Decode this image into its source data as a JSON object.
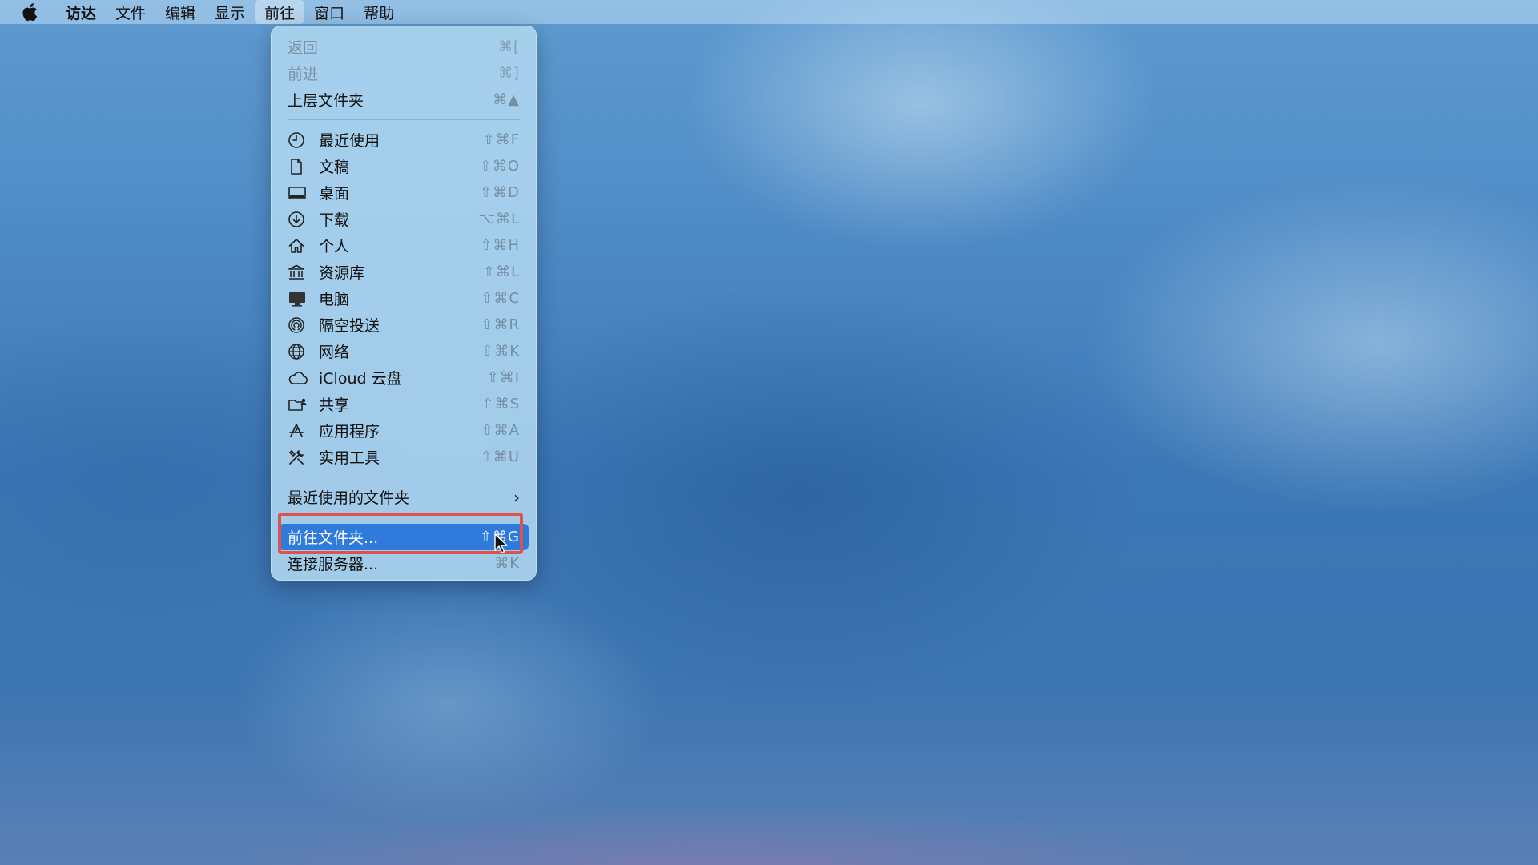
{
  "menubar": {
    "apple_icon": "apple-logo-icon",
    "items": [
      {
        "label": "访达",
        "bold": true
      },
      {
        "label": "文件"
      },
      {
        "label": "编辑"
      },
      {
        "label": "显示"
      },
      {
        "label": "前往",
        "active": true
      },
      {
        "label": "窗口"
      },
      {
        "label": "帮助"
      }
    ]
  },
  "go_menu": {
    "top_items": [
      {
        "label": "返回",
        "shortcut": "⌘[",
        "disabled": true
      },
      {
        "label": "前进",
        "shortcut": "⌘]",
        "disabled": true
      },
      {
        "label": "上层文件夹",
        "shortcut": "⌘▲",
        "disabled": false
      }
    ],
    "places": [
      {
        "label": "最近使用",
        "shortcut": "⇧⌘F",
        "icon": "clock-icon"
      },
      {
        "label": "文稿",
        "shortcut": "⇧⌘O",
        "icon": "document-icon"
      },
      {
        "label": "桌面",
        "shortcut": "⇧⌘D",
        "icon": "desktop-icon"
      },
      {
        "label": "下载",
        "shortcut": "⌥⌘L",
        "icon": "download-icon"
      },
      {
        "label": "个人",
        "shortcut": "⇧⌘H",
        "icon": "home-icon"
      },
      {
        "label": "资源库",
        "shortcut": "⇧⌘L",
        "icon": "library-icon"
      },
      {
        "label": "电脑",
        "shortcut": "⇧⌘C",
        "icon": "computer-icon"
      },
      {
        "label": "隔空投送",
        "shortcut": "⇧⌘R",
        "icon": "airdrop-icon"
      },
      {
        "label": "网络",
        "shortcut": "⇧⌘K",
        "icon": "network-icon"
      },
      {
        "label": "iCloud 云盘",
        "shortcut": "⇧⌘I",
        "icon": "icloud-icon"
      },
      {
        "label": "共享",
        "shortcut": "⇧⌘S",
        "icon": "shared-folder-icon"
      },
      {
        "label": "应用程序",
        "shortcut": "⇧⌘A",
        "icon": "applications-icon"
      },
      {
        "label": "实用工具",
        "shortcut": "⇧⌘U",
        "icon": "utilities-icon"
      }
    ],
    "recent_folders": {
      "label": "最近使用的文件夹",
      "chevron": "›"
    },
    "goto_folder": {
      "label": "前往文件夹...",
      "shortcut": "⇧⌘G",
      "highlighted": true
    },
    "connect_server": {
      "label": "连接服务器...",
      "shortcut": "⌘K"
    }
  },
  "colors": {
    "highlight": "#2e7bdc",
    "annotation_box": "#e0514a"
  }
}
